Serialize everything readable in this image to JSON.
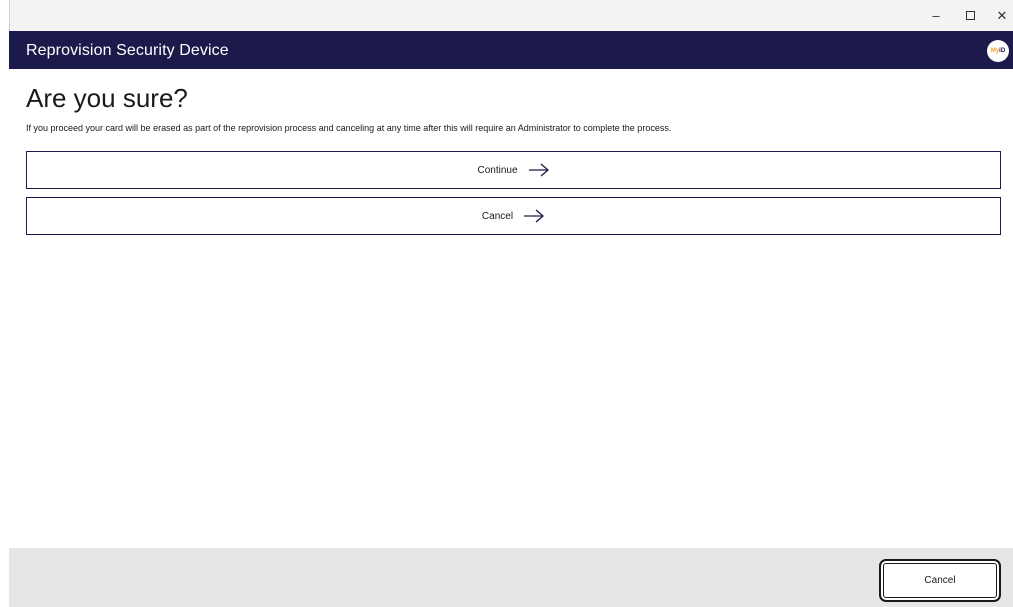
{
  "window": {
    "minimize_glyph": "–",
    "close_glyph": "✕"
  },
  "header": {
    "title": "Reprovision Security Device",
    "logo_text_my": "My",
    "logo_text_id": "iD"
  },
  "main": {
    "heading": "Are you sure?",
    "description": "If you proceed your card will be erased as part of the reprovision process and canceling at any time after this will require an Administrator to complete the process.",
    "options": [
      {
        "label": "Continue",
        "icon": "arrow-right-icon"
      },
      {
        "label": "Cancel",
        "icon": "arrow-right-icon"
      }
    ]
  },
  "footer": {
    "cancel_label": "Cancel"
  },
  "colors": {
    "accent": "#1b1a4a",
    "logo_accent": "#f0a020",
    "footer_bg": "#e6e6e6"
  }
}
